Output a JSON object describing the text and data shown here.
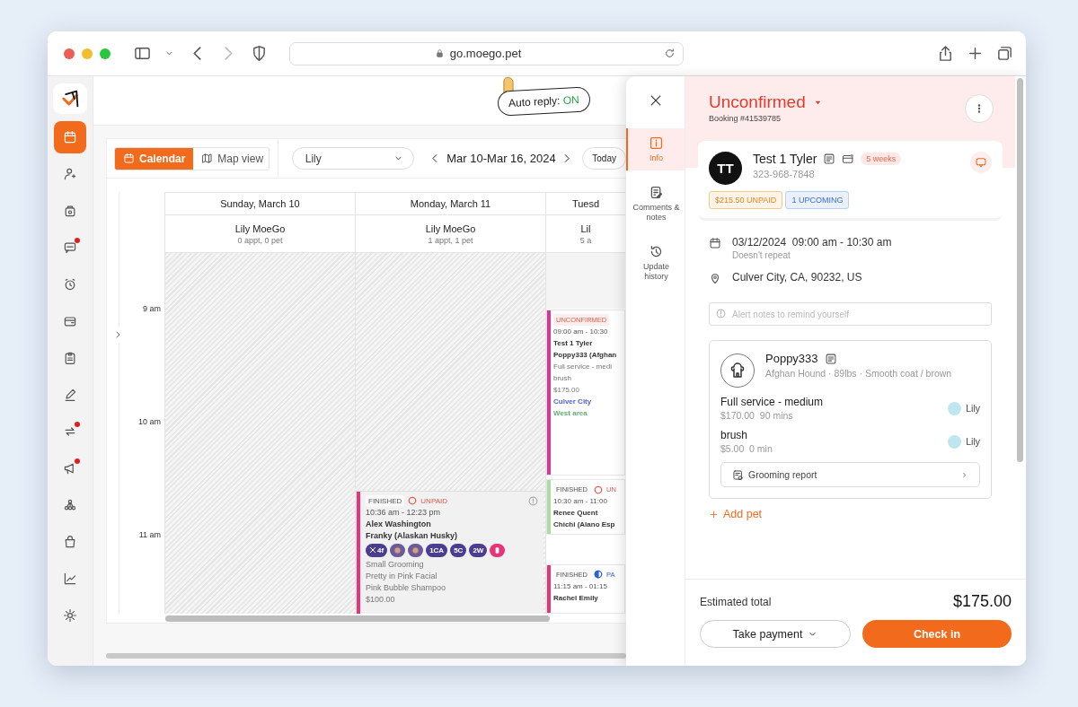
{
  "browser": {
    "url": "go.moego.pet"
  },
  "sidebar": {
    "items": [
      {
        "selected": true,
        "dot": false
      },
      {
        "selected": false,
        "dot": false
      },
      {
        "selected": false,
        "dot": false
      },
      {
        "selected": false,
        "dot": true
      },
      {
        "selected": false,
        "dot": false
      },
      {
        "selected": false,
        "dot": false
      },
      {
        "selected": false,
        "dot": false
      },
      {
        "selected": false,
        "dot": false
      },
      {
        "selected": false,
        "dot": true
      },
      {
        "selected": false,
        "dot": true
      },
      {
        "selected": false,
        "dot": false
      },
      {
        "selected": false,
        "dot": false
      },
      {
        "selected": false,
        "dot": false
      },
      {
        "selected": false,
        "dot": false
      }
    ]
  },
  "header": {
    "auto_reply": {
      "label": "Auto reply:",
      "state": "ON"
    }
  },
  "toolbar": {
    "views": [
      {
        "label": "Calendar",
        "selected": true
      },
      {
        "label": "Map view",
        "selected": false
      }
    ],
    "staff_select": {
      "value": "Lily"
    },
    "date_range": "Mar 10-Mar 16, 2024",
    "today_button": "Today"
  },
  "calendar": {
    "time_labels": [
      "9 am",
      "10 am",
      "11 am"
    ],
    "days": [
      {
        "title": "Sunday, March 10",
        "staff": "Lily MoeGo",
        "summary": "0 appt, 0 pet",
        "blocked": true
      },
      {
        "title": "Monday, March 11",
        "staff": "Lily MoeGo",
        "summary": "1 appt, 1 pet",
        "blocked": true,
        "events": [
          {
            "status": {
              "label": "FINISHED",
              "kind": "finished"
            },
            "payment": {
              "label": "UNPAID",
              "kind": "unpaid"
            },
            "info": true,
            "color": "#e8337a",
            "time": "10:36 am - 12:23 pm",
            "client": "Alex Washington",
            "pet": "Franky (Alaskan Husky)",
            "badges": [
              {
                "kind": "tool",
                "label": "4f"
              },
              {
                "kind": "image"
              },
              {
                "kind": "image"
              },
              {
                "kind": "text",
                "label": "1CA"
              },
              {
                "kind": "text",
                "label": "5C"
              },
              {
                "kind": "text",
                "label": "2W"
              },
              {
                "kind": "pink"
              }
            ],
            "services": [
              "Small Grooming",
              "Pretty in Pink Facial",
              "Pink Bubble Shampoo",
              "$100.00"
            ]
          }
        ]
      },
      {
        "title": "Tuesd",
        "staff": "Lil",
        "summary": "5 a",
        "blocked": false,
        "events": [
          {
            "status": {
              "label": "UNCONFIRMED",
              "kind": "unconfirmed"
            },
            "color": "#e0309a",
            "time": "09:00 am - 10:30",
            "client": "Test 1 Tyler",
            "pet": "Poppy333 (Afghan",
            "services": [
              "Full service - medi",
              "brush",
              "$175.00"
            ],
            "areas": [
              {
                "label": "Culver City",
                "color": "#4f63d9"
              },
              {
                "label": "West area",
                "color": "#5fae73"
              }
            ]
          },
          {
            "status": {
              "label": "FINISHED",
              "kind": "finished"
            },
            "payment": {
              "label": "UN",
              "kind": "unpaid"
            },
            "color": "#a9dca0",
            "time": "10:30 am - 11:00",
            "client": "Renee Quent",
            "pet": "Chichi (Alano Esp"
          },
          {
            "status": {
              "label": "FINISHED",
              "kind": "finished"
            },
            "payment": {
              "label": "PA",
              "kind": "partial"
            },
            "color": "#e8337a",
            "time": "11:15 am - 01:15",
            "client": "Rachel Emily"
          }
        ]
      }
    ]
  },
  "drawer": {
    "nav": [
      {
        "label": "Info",
        "selected": true
      },
      {
        "label": "Comments & notes",
        "selected": false
      },
      {
        "label": "Update history",
        "selected": false
      }
    ],
    "status": "Unconfirmed",
    "booking": "Booking #41539785",
    "client": {
      "initials": "TT",
      "name": "Test 1 Tyler",
      "frequency": "5 weeks",
      "phone": "323-968-7848",
      "tags": [
        {
          "label": "$215.50 UNPAID",
          "kind": "unpaid"
        },
        {
          "label": "1 UPCOMING",
          "kind": "upcoming"
        }
      ]
    },
    "schedule": {
      "date": "03/12/2024",
      "time": "09:00 am - 10:30 am",
      "repeat": "Doesn't repeat",
      "location": "Culver City, CA, 90232, US"
    },
    "alert_notes": {
      "placeholder": "Alert notes to remind yourself"
    },
    "pet": {
      "name": "Poppy333",
      "details": "Afghan Hound · 89lbs · Smooth coat / brown",
      "services": [
        {
          "name": "Full service - medium",
          "price": "$170.00",
          "duration": "90 mins",
          "staff": "Lily"
        },
        {
          "name": "brush",
          "price": "$5.00",
          "duration": "0 min",
          "staff": "Lily"
        }
      ],
      "report": "Grooming report"
    },
    "add_pet": "Add pet",
    "total": {
      "label": "Estimated total",
      "value": "$175.00"
    },
    "take_payment": "Take payment",
    "check_in": "Check in"
  }
}
